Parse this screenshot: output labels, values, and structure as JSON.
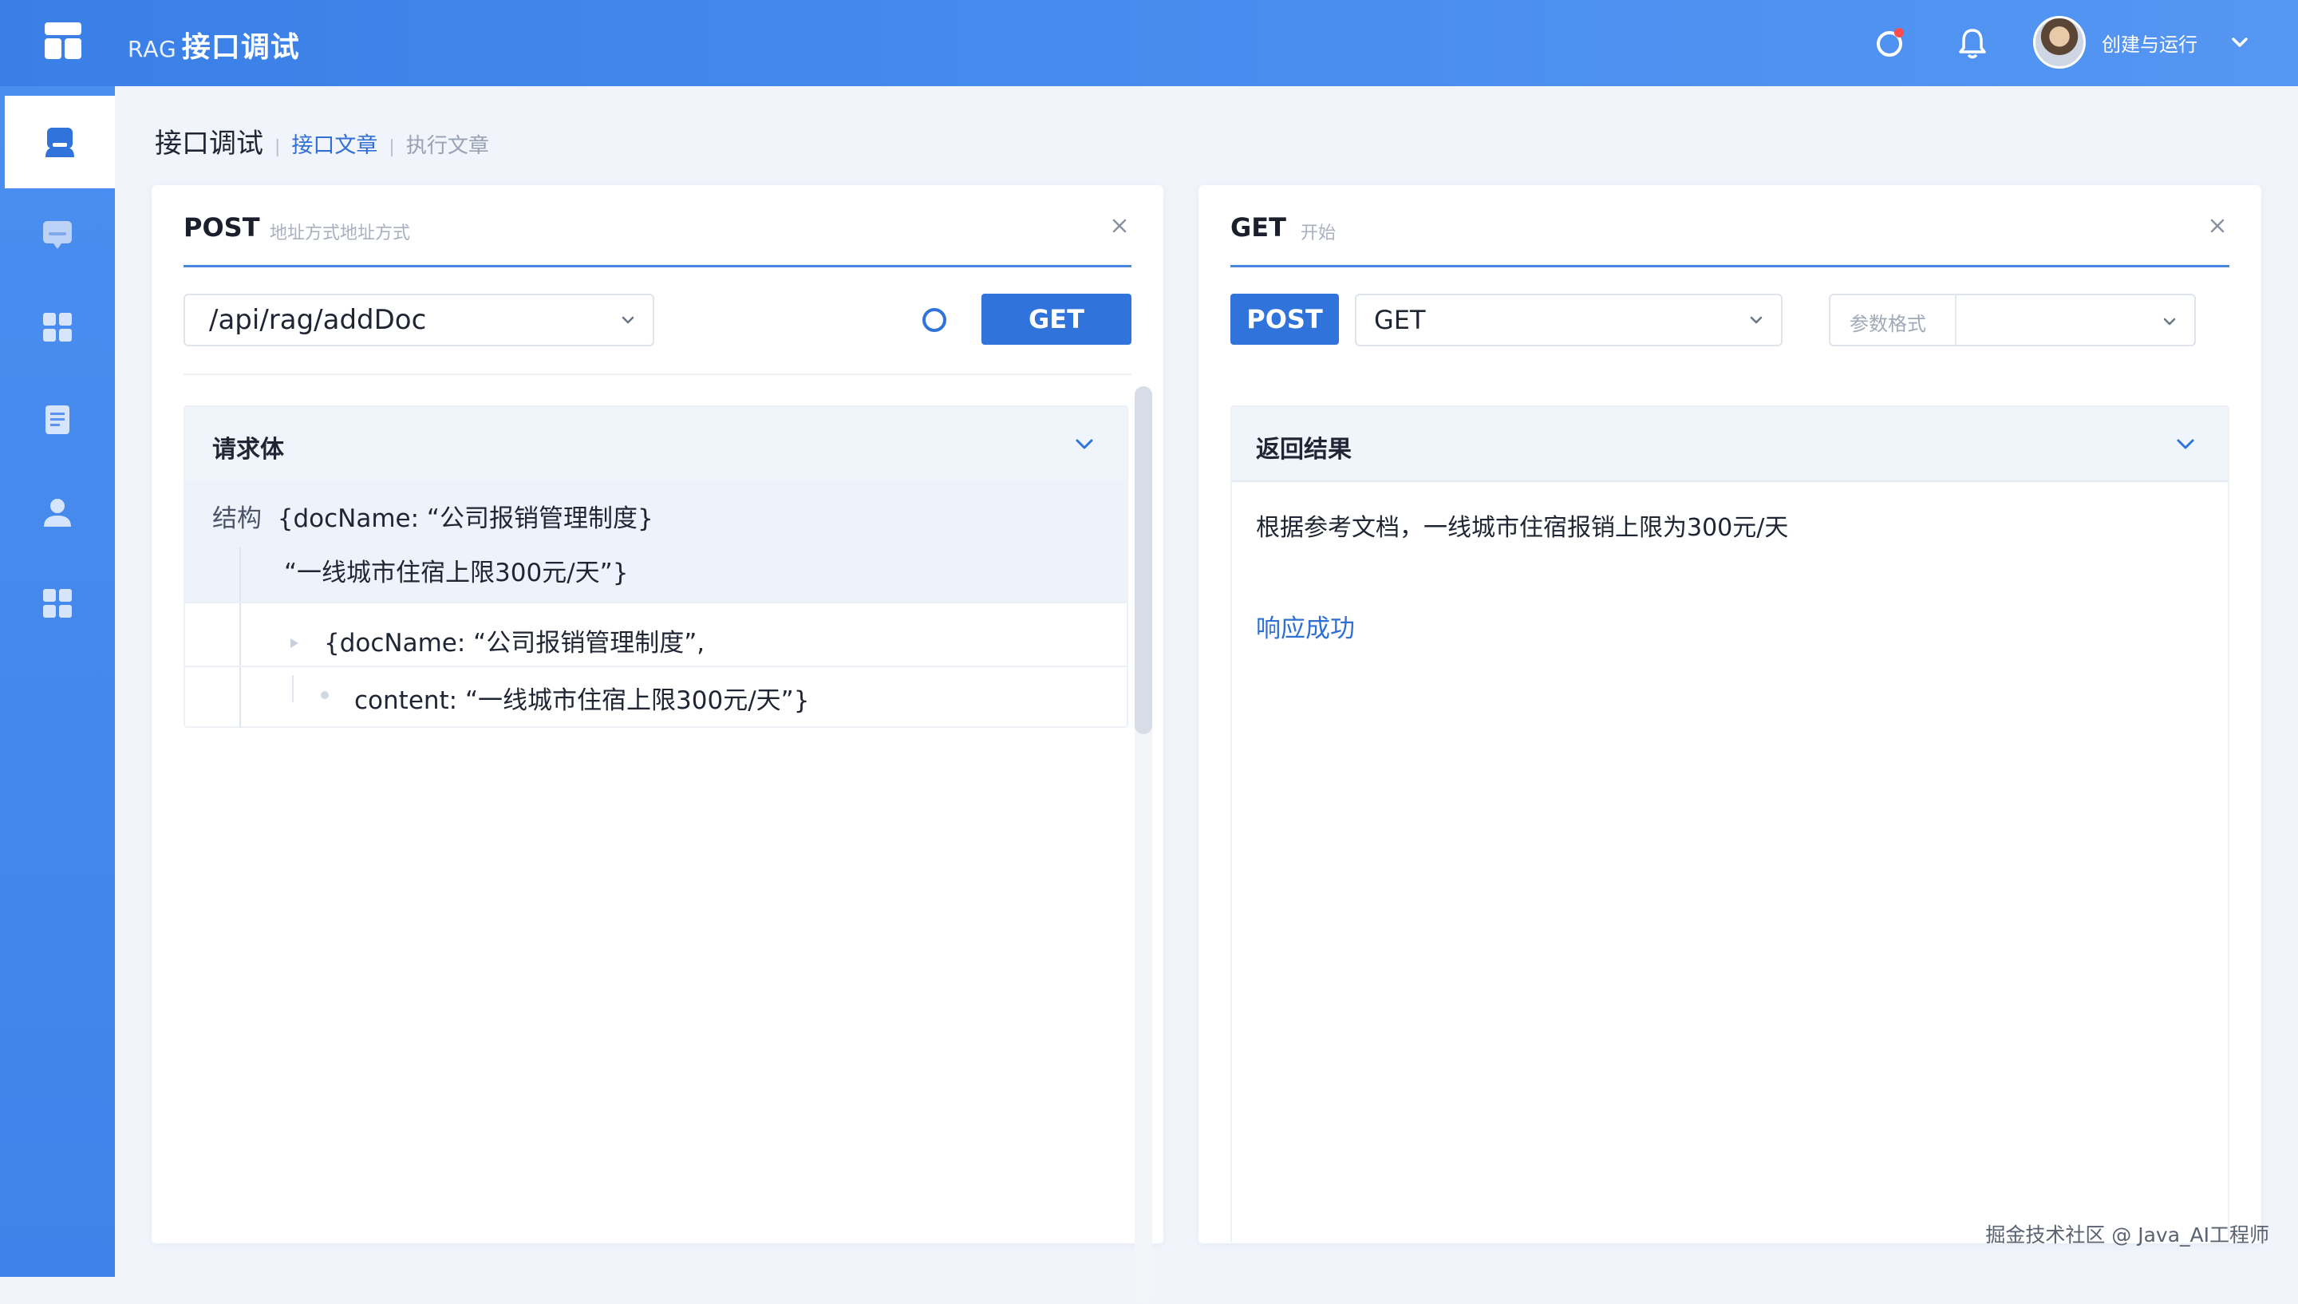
{
  "app": {
    "title_prefix": "RAG",
    "title": "接口调试",
    "username": "创建与运行",
    "colors": {
      "primary": "#2f73db",
      "header": "#4a8ef0",
      "link": "#2f6fd6"
    }
  },
  "header_icons": [
    "refresh-icon",
    "bell-icon",
    "avatar",
    "chevron-down-icon"
  ],
  "sidebar": {
    "items": [
      {
        "icon": "robot-icon",
        "active": true
      },
      {
        "icon": "chat-icon",
        "active": false
      },
      {
        "icon": "grid-icon",
        "active": false
      },
      {
        "icon": "document-icon",
        "active": false
      },
      {
        "icon": "user-icon",
        "active": false
      },
      {
        "icon": "apps-icon",
        "active": false
      }
    ]
  },
  "breadcrumb": {
    "main": "接口调试",
    "link": "接口文章",
    "muted": "执行文章"
  },
  "left_panel": {
    "method": "POST",
    "hint": "地址方式地址方式",
    "url": "/api/rag/addDoc",
    "send_button": "GET",
    "section_title": "请求体",
    "code": {
      "label": "结构",
      "line1": "{docName: “公司报销管理制度}",
      "line2": "“一线城市住宿上限300元/天”}",
      "line3": "{docName: “公司报销管理制度”,",
      "line4": "content: “一线城市住宿上限300元/天”}"
    }
  },
  "right_panel": {
    "method": "GET",
    "hint": "开始",
    "method_button": "POST",
    "method_select": "GET",
    "params_label": "参数格式",
    "params_value": "",
    "section_title": "返回结果",
    "result_text": "根据参考文档，一线城市住宿报销上限为300元/天",
    "status": "响应成功"
  },
  "watermark": "掘金技术社区 @ Java_AI工程师"
}
